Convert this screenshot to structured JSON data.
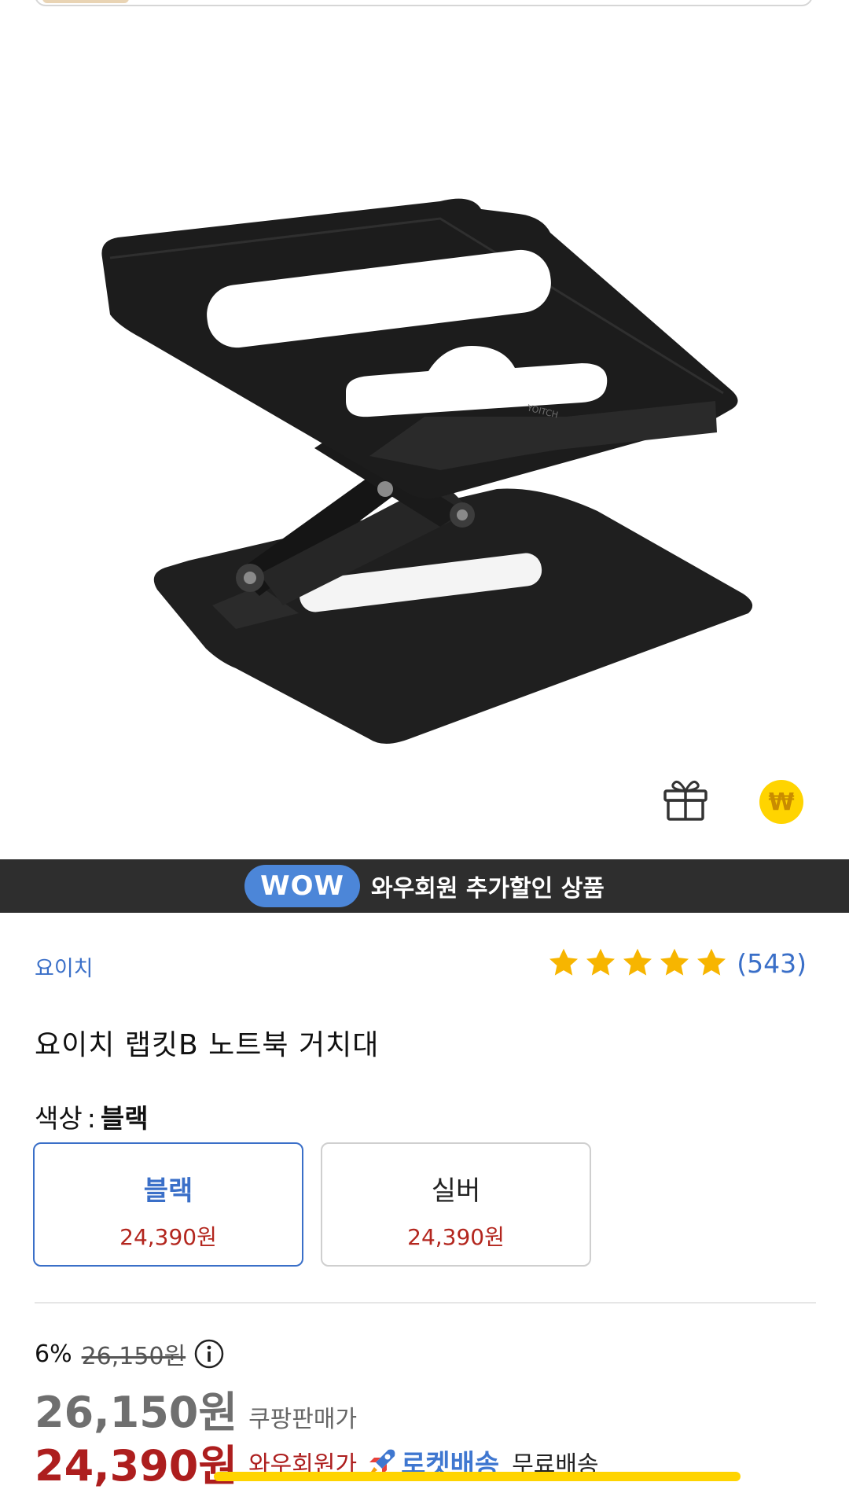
{
  "product": {
    "brand": "요이치",
    "title": "요이치 랩킷B 노트북 거치대",
    "review_count": "(543)",
    "rating_stars": 5
  },
  "wow_banner": {
    "badge": "WOW",
    "text": "와우회원 추가할인 상품"
  },
  "options": {
    "label": "색상",
    "separator": ":",
    "selected": "블랙",
    "items": [
      {
        "name": "블랙",
        "price": "24,390원",
        "selected": true
      },
      {
        "name": "실버",
        "price": "24,390원",
        "selected": false
      }
    ]
  },
  "pricing": {
    "discount_rate": "6%",
    "original_price": "26,150원",
    "sale_price": "26,150원",
    "sale_label": "쿠팡판매가",
    "wow_price": "24,390원",
    "wow_label": "와우회원가",
    "rocket_label": "로켓배송",
    "free_shipping": "무료배송"
  },
  "icons": {
    "gift": "gift-icon",
    "coin": "coin-icon",
    "star": "star-icon",
    "info": "info-icon",
    "rocket": "rocket-icon"
  },
  "colors": {
    "accent_blue": "#3a6fc8",
    "price_red": "#ad1e1e",
    "star_yellow": "#f7b500",
    "banner_bg": "#2e2e2e",
    "wow_badge": "#4c86d8"
  }
}
